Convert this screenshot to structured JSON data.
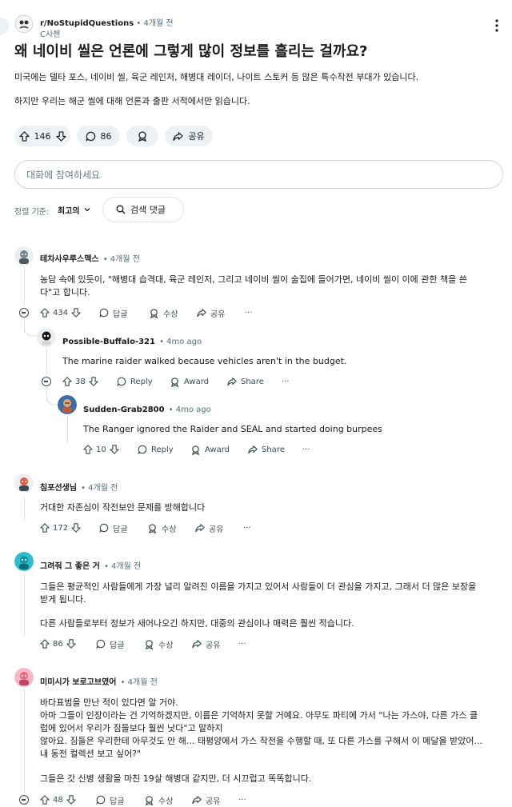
{
  "post": {
    "subreddit": "r/NoStupidQuestions",
    "age": "• 4개월 전",
    "user": "C사첸",
    "title": "왜 네이비 씰은 언론에 그렇게 많이 정보를 흘리는 걸까요?",
    "body": [
      "미국에는 델타 포스, 네이비 씰, 육군 레인저, 해병대 레이더, 나이트 스토커 등 많은 특수작전 부대가 있습니다.",
      "하지만 우리는 해군 씰에 대해 언론과 출판 서적에서만 읽습니다."
    ],
    "votes": "146",
    "comments": "86",
    "share_label": "공유"
  },
  "composer": {
    "placeholder": "대화에 참여하세요"
  },
  "sort": {
    "label": "정렬 기준:",
    "value": "최고의",
    "search_label": "검색 댓글"
  },
  "comments": [
    {
      "author": "테차사우루스맥스",
      "age": "• 4개월 전",
      "text": [
        "농담 속에 있듯이, \"해병대 습격대, 육군 레인저, 그리고 네이비 씰이 술집에 들어가면, 네이비 씰이 이에 관한 책을 쓴",
        "다\"고 합니다."
      ],
      "votes": "434",
      "reply": "답글",
      "award": "수상",
      "share": "공유",
      "more": "···"
    },
    {
      "author": "Possible-Buffalo-321",
      "age": "• 4mo ago",
      "text": [
        "The marine raider walked because vehicles aren't in the budget."
      ],
      "votes": "38",
      "reply": "Reply",
      "award": "Award",
      "share": "Share",
      "more": "···"
    },
    {
      "author": "Sudden-Grab2800",
      "age": "• 4mo ago",
      "text": [
        "The Ranger ignored the Raider and SEAL and started doing burpees"
      ],
      "votes": "10",
      "reply": "Reply",
      "award": "Award",
      "share": "Share",
      "more": "···"
    },
    {
      "author": "침포선생님",
      "age": "• 4개월 전",
      "text": [
        "거대한 자존심이 작전보안 문제를 방해합니다"
      ],
      "votes": "172",
      "reply": "답글",
      "award": "수상",
      "share": "공유",
      "more": "···"
    },
    {
      "author": "그려줘 그 좋은 거",
      "age": "• 4개월 전",
      "text": [
        "그들은 평균적인 사람들에게 가장 널리 알려진 이름을 가지고 있어서 사람들이 더 관심을 가지고, 그래서 더 많은 보장을",
        "받게 됩니다.",
        "다른 사람들로부터 정보가 새어나오긴 하지만, 대중의 관심이나 매력은 훨씬 적습니다."
      ],
      "votes": "86",
      "reply": "답글",
      "award": "수상",
      "share": "공유",
      "more": "···"
    },
    {
      "author": "미미시가 보로고브였어",
      "age": "• 4개월 전",
      "text": [
        "바다표범을 만난 적이 있다면 알 거야.",
        "아마 그들이 인장이라는 건 기억하겠지만, 이름은 기억하지 못할 거예요. 아무도 파티에 가서 \"나는 가스야, 다른 가스 클",
        "럽에 있어서 우리가 짐들보다 훨씬 낫다\"고 말하지",
        "않아요. 짐들은 우리한테 아무것도 안 해... 태평양에서 가스 작전을 수행할 때, 또 다른 가스를 구해서 이 메달을 받았어...",
        "내 동전 컬렉션 보고 싶어?\"",
        "그들은 갓 신병 생활을 마친 19살 해병대 같지만, 더 시끄럽고 똑똑합니다."
      ],
      "votes": "48",
      "reply": "답글",
      "award": "수상",
      "share": "공유",
      "more": "···"
    }
  ],
  "colors": {
    "pill_bg": "#eef1f3",
    "meta": "#576f76",
    "rail": "#dfe3e6"
  }
}
